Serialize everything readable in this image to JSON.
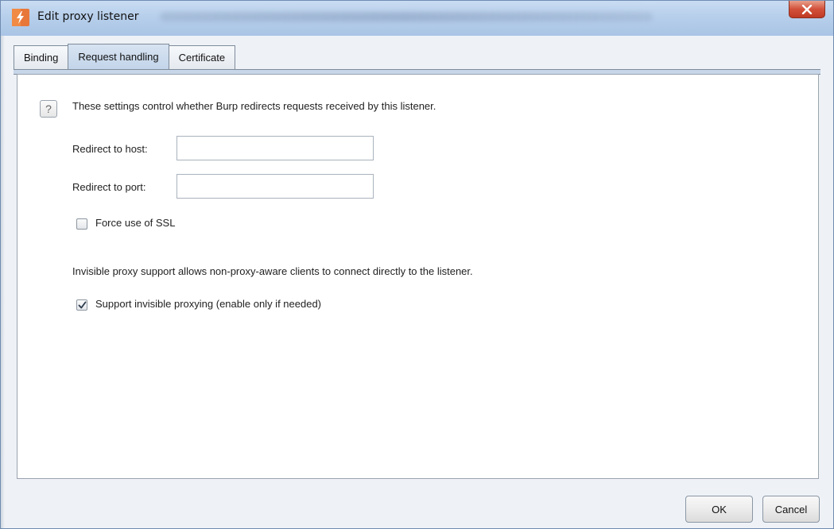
{
  "window": {
    "title": "Edit proxy listener",
    "close_icon": "close-icon",
    "app_icon": "burp-lightning-icon"
  },
  "tabs": [
    {
      "label": "Binding",
      "active": false
    },
    {
      "label": "Request handling",
      "active": true
    },
    {
      "label": "Certificate",
      "active": false
    }
  ],
  "panel": {
    "help_icon": "?",
    "intro": "These settings control whether Burp redirects requests received by this listener.",
    "redirect_host_label": "Redirect to host:",
    "redirect_host_value": "",
    "redirect_port_label": "Redirect to port:",
    "redirect_port_value": "",
    "force_ssl_label": "Force use of SSL",
    "force_ssl_checked": false,
    "invisible_note": "Invisible proxy support allows non-proxy-aware clients to connect directly to the listener.",
    "invisible_label": "Support invisible proxying (enable only if needed)",
    "invisible_checked": true
  },
  "buttons": {
    "ok": "OK",
    "cancel": "Cancel"
  },
  "colors": {
    "titlebar": "#b7cfeb",
    "close_button": "#d2503a",
    "active_tab": "#c3d5ea",
    "panel_bg": "#ffffff"
  }
}
